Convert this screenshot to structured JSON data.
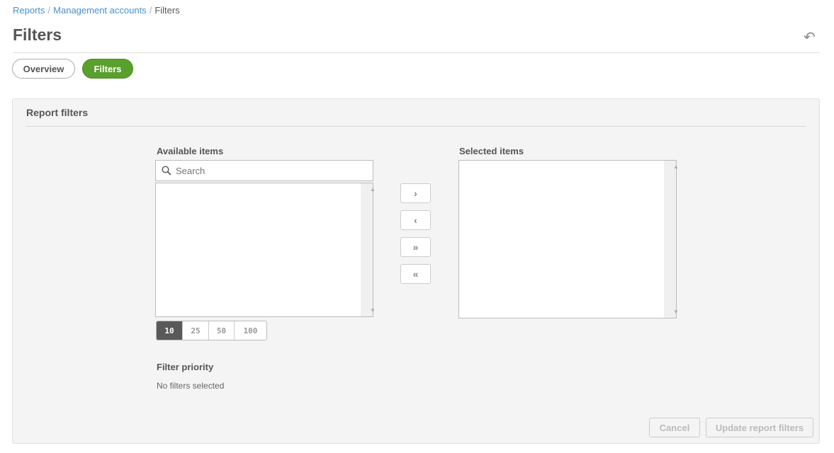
{
  "breadcrumb": [
    "Reports",
    "Management accounts",
    "Filters"
  ],
  "title": "Filters",
  "tabs": [
    "Overview",
    "Filters"
  ],
  "panel": {
    "title": "Report filters",
    "available_label": "Available items",
    "selected_label": "Selected items",
    "search_placeholder": "Search",
    "move": {
      "one_right": "›",
      "one_left": "‹",
      "all_right": "»",
      "all_left": "«"
    },
    "page_sizes": [
      "10",
      "25",
      "50",
      "100"
    ],
    "priority_label": "Filter priority",
    "priority_text": "No filters selected",
    "cancel": "Cancel",
    "update": "Update report filters"
  }
}
